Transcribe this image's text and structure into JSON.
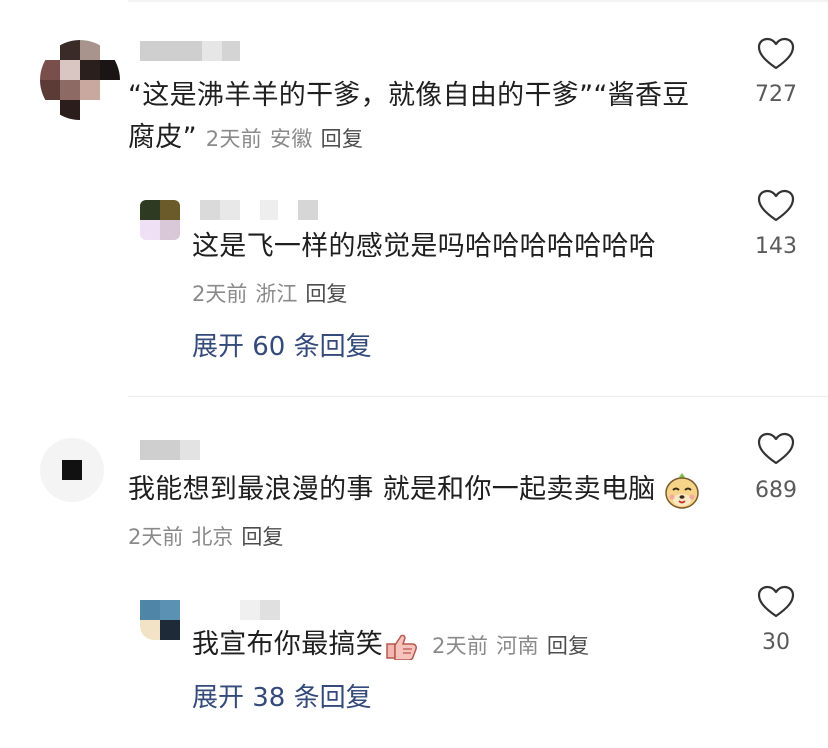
{
  "comments": [
    {
      "text": "“这是沸羊羊的干爹，就像自由的干爹”“酱香豆腐皮”",
      "text_line1": "“这是沸羊羊的干爹，就像自由的干爹”“酱香豆",
      "text_line2": "腐皮”",
      "time": "2天前",
      "location": "安徽",
      "reply_label": "回复",
      "likes": "727"
    },
    {
      "text": "这是飞一样的感觉是吗哈哈哈哈哈哈哈",
      "time": "2天前",
      "location": "浙江",
      "reply_label": "回复",
      "likes": "143",
      "expand_label": "展开 60 条回复"
    },
    {
      "text": "我能想到最浪漫的事 就是和你一起卖卖电脑",
      "emoji": "dog-face-emoji",
      "time": "2天前",
      "location": "北京",
      "reply_label": "回复",
      "likes": "689"
    },
    {
      "text": "我宣布你最搞笑",
      "emoji": "thumbs-up-emoji",
      "time": "2天前",
      "location": "河南",
      "reply_label": "回复",
      "likes": "30",
      "expand_label": "展开 38 条回复"
    }
  ],
  "icons": {
    "like": "heart-outline-icon"
  },
  "colors": {
    "text": "#1f1f1f",
    "meta": "#8a8a8a",
    "expand": "#344a7a",
    "likes": "#5a5a5a"
  }
}
